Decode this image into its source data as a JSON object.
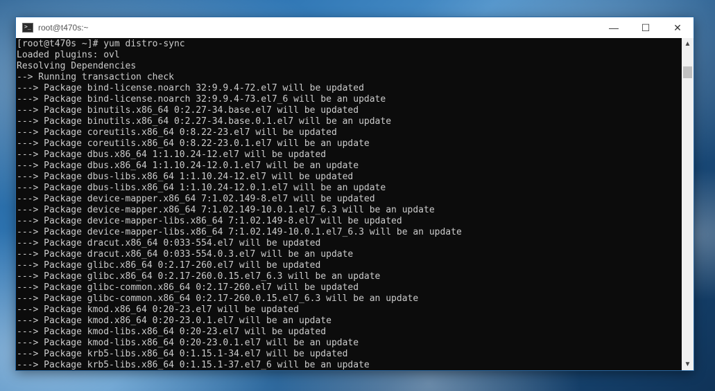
{
  "window": {
    "title": "root@t470s:~",
    "icon": "terminal-icon",
    "controls": {
      "minimize": "—",
      "maximize": "☐",
      "close": "✕"
    }
  },
  "terminal": {
    "lines": [
      "[root@t470s ~]# yum distro-sync",
      "Loaded plugins: ovl",
      "Resolving Dependencies",
      "--> Running transaction check",
      "---> Package bind-license.noarch 32:9.9.4-72.el7 will be updated",
      "---> Package bind-license.noarch 32:9.9.4-73.el7_6 will be an update",
      "---> Package binutils.x86_64 0:2.27-34.base.el7 will be updated",
      "---> Package binutils.x86_64 0:2.27-34.base.0.1.el7 will be an update",
      "---> Package coreutils.x86_64 0:8.22-23.el7 will be updated",
      "---> Package coreutils.x86_64 0:8.22-23.0.1.el7 will be an update",
      "---> Package dbus.x86_64 1:1.10.24-12.el7 will be updated",
      "---> Package dbus.x86_64 1:1.10.24-12.0.1.el7 will be an update",
      "---> Package dbus-libs.x86_64 1:1.10.24-12.el7 will be updated",
      "---> Package dbus-libs.x86_64 1:1.10.24-12.0.1.el7 will be an update",
      "---> Package device-mapper.x86_64 7:1.02.149-8.el7 will be updated",
      "---> Package device-mapper.x86_64 7:1.02.149-10.0.1.el7_6.3 will be an update",
      "---> Package device-mapper-libs.x86_64 7:1.02.149-8.el7 will be updated",
      "---> Package device-mapper-libs.x86_64 7:1.02.149-10.0.1.el7_6.3 will be an update",
      "---> Package dracut.x86_64 0:033-554.el7 will be updated",
      "---> Package dracut.x86_64 0:033-554.0.3.el7 will be an update",
      "---> Package glibc.x86_64 0:2.17-260.el7 will be updated",
      "---> Package glibc.x86_64 0:2.17-260.0.15.el7_6.3 will be an update",
      "---> Package glibc-common.x86_64 0:2.17-260.el7 will be updated",
      "---> Package glibc-common.x86_64 0:2.17-260.0.15.el7_6.3 will be an update",
      "---> Package kmod.x86_64 0:20-23.el7 will be updated",
      "---> Package kmod.x86_64 0:20-23.0.1.el7 will be an update",
      "---> Package kmod-libs.x86_64 0:20-23.el7 will be updated",
      "---> Package kmod-libs.x86_64 0:20-23.0.1.el7 will be an update",
      "---> Package krb5-libs.x86_64 0:1.15.1-34.el7 will be updated",
      "---> Package krb5-libs.x86_64 0:1.15.1-37.el7_6 will be an update"
    ]
  },
  "scrollbar": {
    "up_arrow": "▲",
    "down_arrow": "▼"
  }
}
